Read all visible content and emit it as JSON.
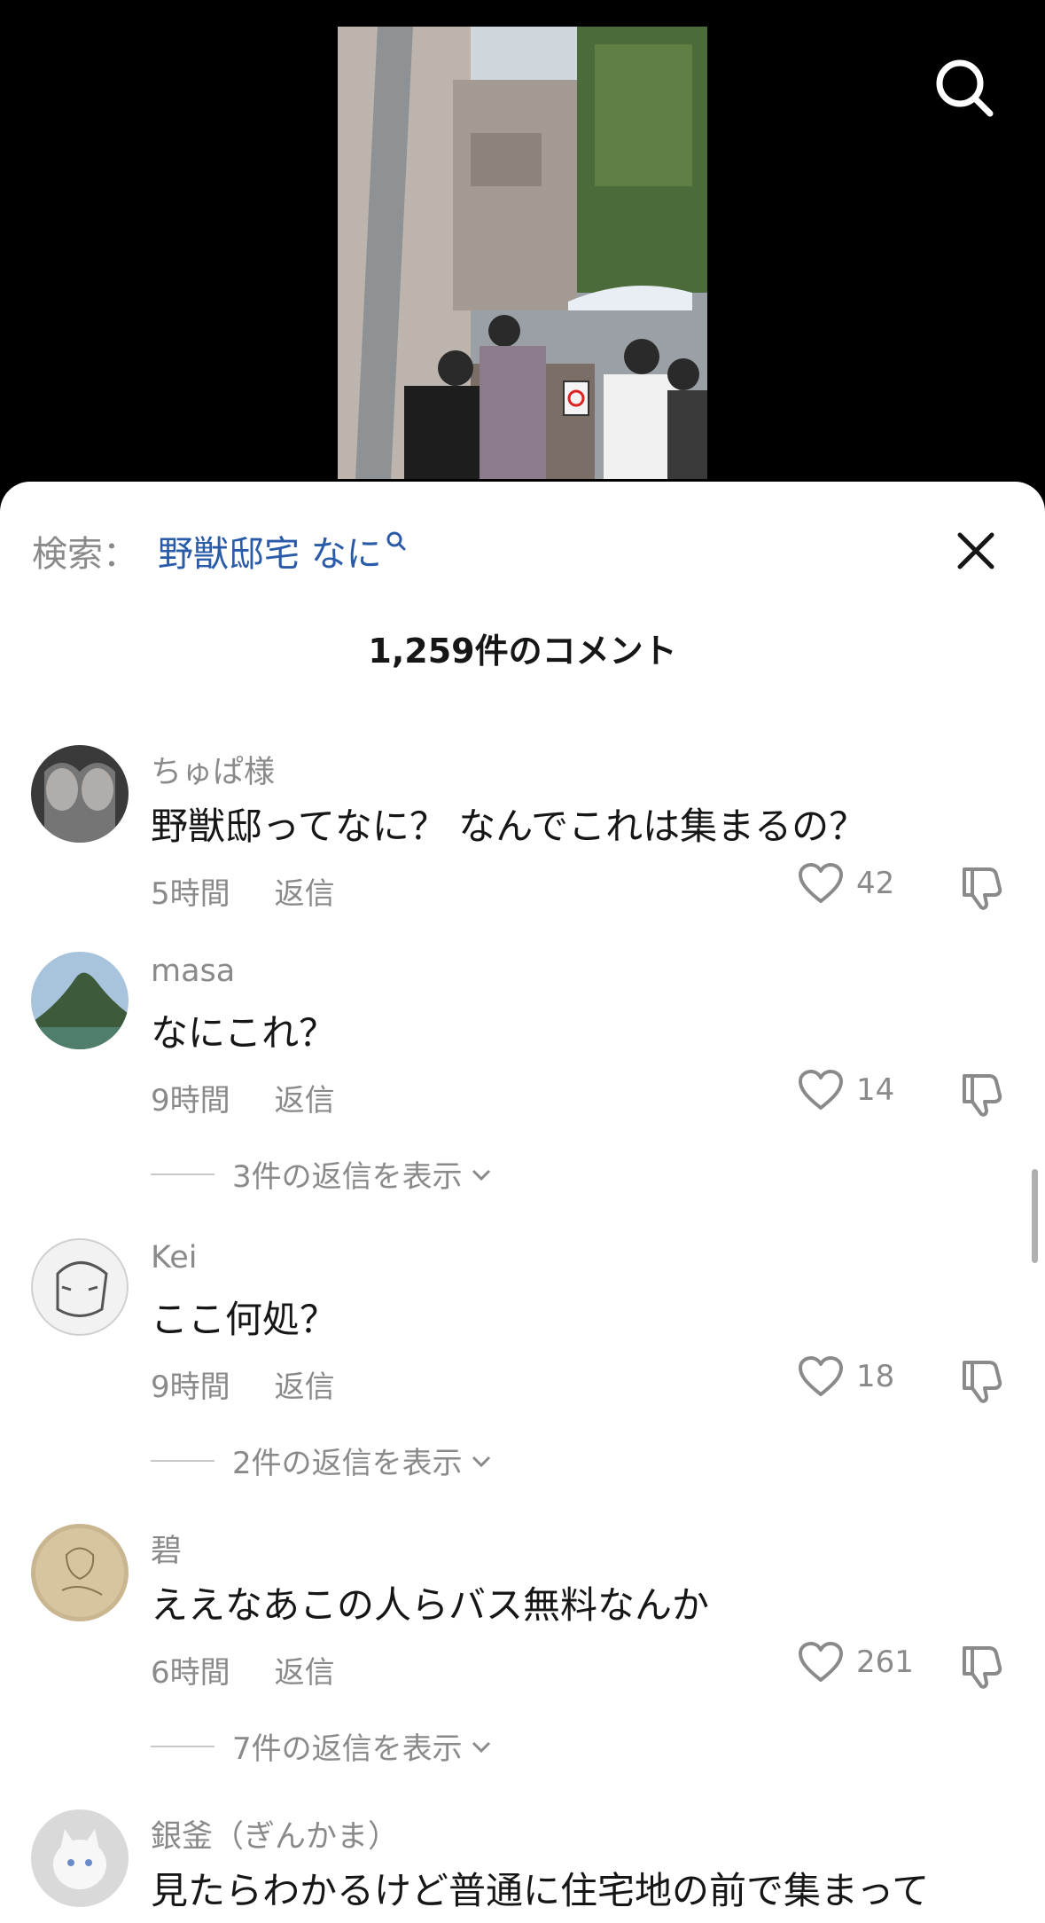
{
  "search": {
    "prefix": "検索：",
    "term": "野獣邸宅 なに"
  },
  "comment_count_label": "1,259件のコメント",
  "comments": [
    {
      "username": "ちゅぱ様",
      "text": "野獣邸ってなに？ なんでこれは集まるの？",
      "time": "5時間",
      "reply_label": "返信",
      "likes": "42"
    },
    {
      "username": "masa",
      "text": "なにこれ？",
      "time": "9時間",
      "reply_label": "返信",
      "likes": "14",
      "view_replies": "3件の返信を表示"
    },
    {
      "username": "Kei",
      "text": "ここ何処？",
      "time": "9時間",
      "reply_label": "返信",
      "likes": "18",
      "view_replies": "2件の返信を表示"
    },
    {
      "username": "碧",
      "text": "ええなあこの人らバス無料なんか",
      "time": "6時間",
      "reply_label": "返信",
      "likes": "261",
      "view_replies": "7件の返信を表示"
    },
    {
      "username": "銀釜（ぎんかま）",
      "text": "見たらわかるけど普通に住宅地の前で集まって"
    }
  ],
  "icons": {
    "top_search": "search-icon",
    "close": "close-icon",
    "like": "heart-icon",
    "dislike": "thumbs-down-icon",
    "expand": "chevron-down-icon"
  }
}
